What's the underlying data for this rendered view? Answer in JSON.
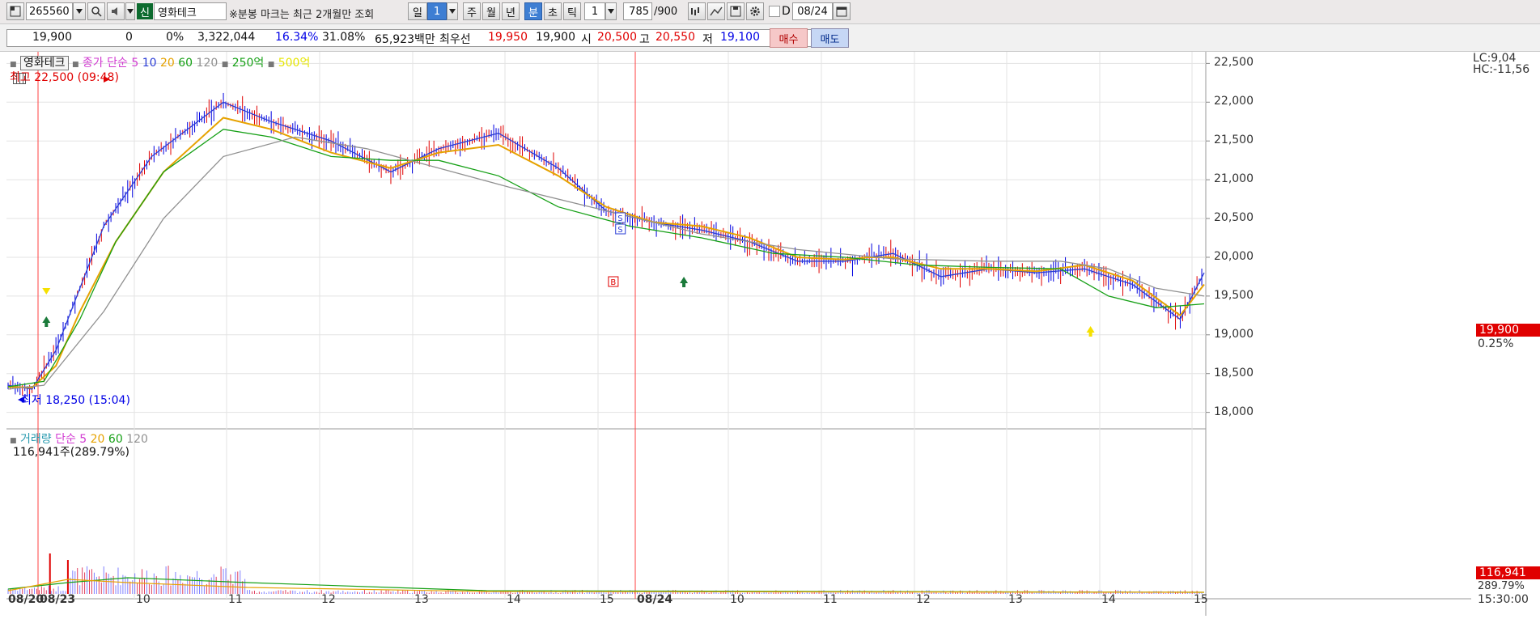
{
  "toolbar": {
    "code": "265560",
    "sin_badge": "신",
    "stock_name": "영화테크",
    "notice": "※분봉 마크는 최근 2개월만 조회",
    "period_day": "일",
    "period_num": "1",
    "week": "주",
    "month": "월",
    "year": "년",
    "minute": "분",
    "second": "초",
    "tick": "틱",
    "interval_value": "1",
    "count": "785",
    "count_total": "/900",
    "date_check_label": "D",
    "date_value": "08/24"
  },
  "info": {
    "price": "19,900",
    "change": "0",
    "change_pct": "0%",
    "volume": "3,322,044",
    "pct_a": "16.34%",
    "pct_b": "31.08%",
    "amount": "65,923백만",
    "best_label": "최우선",
    "best_ask": "19,950",
    "best_bid": "19,900",
    "open_label": "시",
    "open": "20,500",
    "high_label": "고",
    "high": "20,550",
    "low_label": "저",
    "low": "19,100",
    "buy": "매수",
    "sell": "매도"
  },
  "price_panel": {
    "name_box": "영화테크",
    "ma_label": "종가 단순 5",
    "ma10": "10",
    "ma20": "20",
    "ma60": "60",
    "ma120": "120",
    "amt250": "250억",
    "amt500": "500억",
    "high_marker": "최고 22,500 (09:48)",
    "low_marker": "최저 18,250 (15:04)",
    "lc": "LC:9,04",
    "hc": "HC:-11,56",
    "current_tag": "19,900",
    "current_pct": "0.25%"
  },
  "volume_panel": {
    "label": "거래량",
    "ma_label": "단순 5",
    "ma20": "20",
    "ma60": "60",
    "ma120": "120",
    "value_text": "116,941주(289.79%)",
    "current_tag": "116,941",
    "current_pct": "289.79%"
  },
  "y_axis": [
    "22,500",
    "22,000",
    "21,500",
    "21,000",
    "20,500",
    "20,000",
    "19,500",
    "19,000",
    "18,500",
    "18,000"
  ],
  "x_axis": [
    "08/20",
    "08/23",
    "10",
    "11",
    "12",
    "13",
    "14",
    "15",
    "08/24",
    "10",
    "11",
    "12",
    "13",
    "14",
    "15",
    "15:30:00"
  ],
  "colors": {
    "ma5": "#2a3cd6",
    "ma10": "#e6a200",
    "ma20": "#16a016",
    "ma60": "#909090",
    "up": "#e00000",
    "down": "#0000e0"
  },
  "chart_data": {
    "type": "line",
    "ylim": [
      17850,
      22650
    ],
    "y_ticks": [
      18000,
      18500,
      19000,
      19500,
      20000,
      20500,
      21000,
      21500,
      22000,
      22500
    ],
    "x_ticks": [
      "08/20",
      "08/23",
      "10",
      "11",
      "12",
      "13",
      "14",
      "15",
      "08/24",
      "10",
      "11",
      "12",
      "13",
      "14",
      "15"
    ],
    "series": [
      {
        "name": "5",
        "x": [
          0,
          2,
          4,
          6,
          8,
          12,
          18,
          22,
          27,
          32,
          36,
          41,
          46,
          50,
          54,
          58,
          62,
          66,
          70,
          72,
          74,
          78,
          82,
          86,
          90,
          94,
          98,
          100
        ],
        "values": [
          18350,
          18300,
          18800,
          19600,
          20400,
          21300,
          22000,
          21750,
          21500,
          21100,
          21400,
          21600,
          21150,
          20600,
          20450,
          20350,
          20200,
          19950,
          19950,
          20000,
          20050,
          19750,
          19850,
          19800,
          19850,
          19650,
          19200,
          19800
        ]
      },
      {
        "name": "10",
        "x": [
          0,
          2,
          4,
          6,
          9,
          13,
          18,
          22,
          27,
          32,
          36,
          41,
          46,
          50,
          54,
          58,
          62,
          66,
          70,
          72,
          74,
          78,
          82,
          86,
          90,
          94,
          98,
          100
        ],
        "values": [
          18330,
          18320,
          18600,
          19300,
          20200,
          21100,
          21800,
          21650,
          21350,
          21150,
          21350,
          21450,
          21050,
          20650,
          20450,
          20400,
          20250,
          20000,
          19970,
          20000,
          20000,
          19850,
          19850,
          19820,
          19900,
          19700,
          19250,
          19650
        ]
      },
      {
        "name": "20",
        "x": [
          0,
          3,
          6,
          9,
          13,
          18,
          22,
          27,
          32,
          36,
          41,
          46,
          52,
          58,
          64,
          70,
          76,
          82,
          88,
          92,
          96,
          100
        ],
        "values": [
          18330,
          18400,
          19200,
          20200,
          21100,
          21650,
          21550,
          21300,
          21250,
          21250,
          21050,
          20650,
          20400,
          20250,
          20050,
          20000,
          19900,
          19870,
          19850,
          19500,
          19350,
          19400
        ]
      },
      {
        "name": "60",
        "x": [
          0,
          3,
          8,
          13,
          18,
          24,
          30,
          36,
          42,
          50,
          58,
          66,
          74,
          82,
          88,
          92,
          96,
          100
        ],
        "values": [
          18300,
          18350,
          19300,
          20500,
          21300,
          21550,
          21400,
          21150,
          20900,
          20600,
          20300,
          20100,
          19980,
          19950,
          19950,
          19850,
          19600,
          19500
        ]
      }
    ]
  }
}
